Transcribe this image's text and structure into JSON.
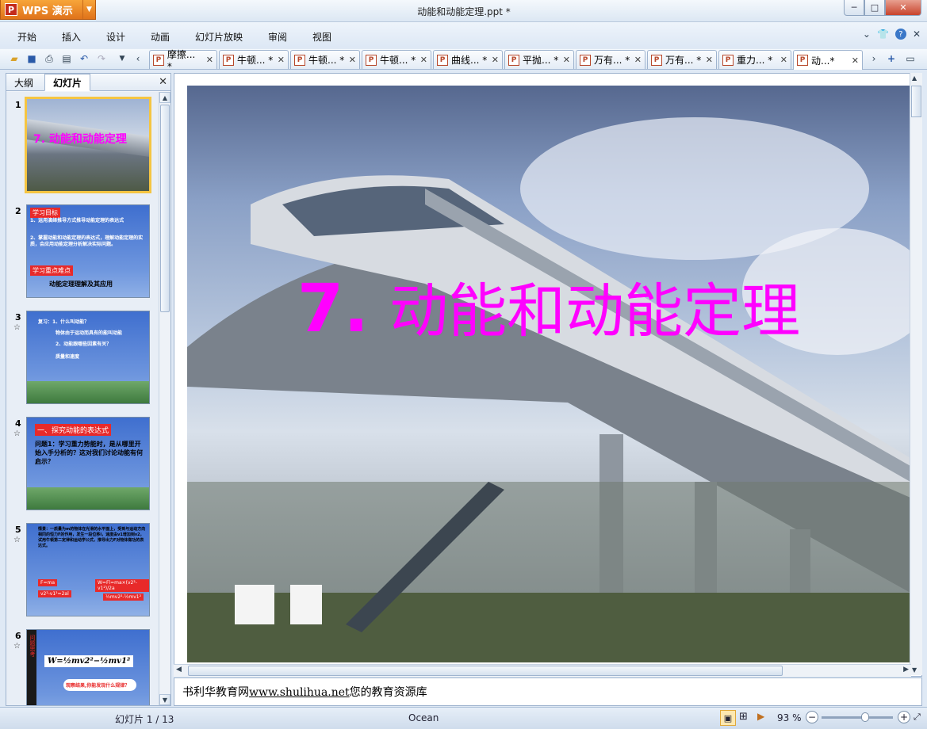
{
  "app": {
    "name": "WPS 演示",
    "logo": "P"
  },
  "window": {
    "title": "动能和动能定理.ppt *",
    "min": "─",
    "max": "□",
    "close": "✕"
  },
  "menu": [
    "开始",
    "插入",
    "设计",
    "动画",
    "幻灯片放映",
    "审阅",
    "视图"
  ],
  "menu_right": {
    "collapse": "⌄",
    "skin": "👕",
    "help": "?"
  },
  "doc_tabs": [
    {
      "label": "摩擦... *",
      "active": false
    },
    {
      "label": "牛顿... *",
      "active": false
    },
    {
      "label": "牛顿... *",
      "active": false
    },
    {
      "label": "牛顿... *",
      "active": false
    },
    {
      "label": "曲线... *",
      "active": false
    },
    {
      "label": "平抛... *",
      "active": false
    },
    {
      "label": "万有... *",
      "active": false
    },
    {
      "label": "万有... *",
      "active": false
    },
    {
      "label": "重力... *",
      "active": false
    },
    {
      "label": "动...*",
      "active": true
    }
  ],
  "tab_close": "✕",
  "side": {
    "tab_outline": "大纲",
    "tab_slides": "幻灯片",
    "close": "✕"
  },
  "slides": [
    {
      "num": "1",
      "star": "",
      "title": "7. 动能和动能定理"
    },
    {
      "num": "2",
      "star": "",
      "tag1": "学习目标",
      "line1": "1、运用演绎推导方式推导动能定理的表达式",
      "line2": "2、掌握动能和动能定理的表达式，理解动能定理的实质，会应用动能定理分析解决实际问题。",
      "tag2": "学习重点难点",
      "line3": "动能定理理解及其应用"
    },
    {
      "num": "3",
      "star": "☆",
      "line1": "复习：1、什么叫动能？",
      "line2": "物体由于运动而具有的能叫动能",
      "line3": "2、动能跟哪些因素有关？",
      "line4": "质量和速度"
    },
    {
      "num": "4",
      "star": "☆",
      "tag1": "一、探究动能的表达式",
      "line1": "问题1：学习重力势能时，是从哪里开始入手分析的？这对我们讨论动能有何启示？"
    },
    {
      "num": "5",
      "star": "☆",
      "line1": "情景：一质量为m的物体在光滑的水平面上，受到与运动方向相同的恒力F的作用，发生一段位移l，速度由v1增加到v2，试用牛顿第二定律和运动学公式，推导出力F对物体做功的表达式。",
      "f1": "F=ma",
      "f2": "v2²-v1²=2al",
      "f3": "W=Fl=ma×(v2²-v1²)/2a",
      "f4": "½mv2²-½mv1²"
    },
    {
      "num": "6",
      "star": "☆",
      "side_label": "问题思考",
      "formula": "W=½mv2²−½mv1²",
      "bubble": "观察结果,你能发现什么规律？"
    }
  ],
  "main_slide": {
    "num": "7.",
    "title": "动能和动能定理"
  },
  "notes": {
    "prefix": "书利华教育网",
    "link": "www.shulihua.net",
    "suffix": "您的教育资源库"
  },
  "status": {
    "slide_info": "幻灯片 1 / 13",
    "theme": "Ocean",
    "zoom": "93 %",
    "zoom_level": 0.62
  }
}
